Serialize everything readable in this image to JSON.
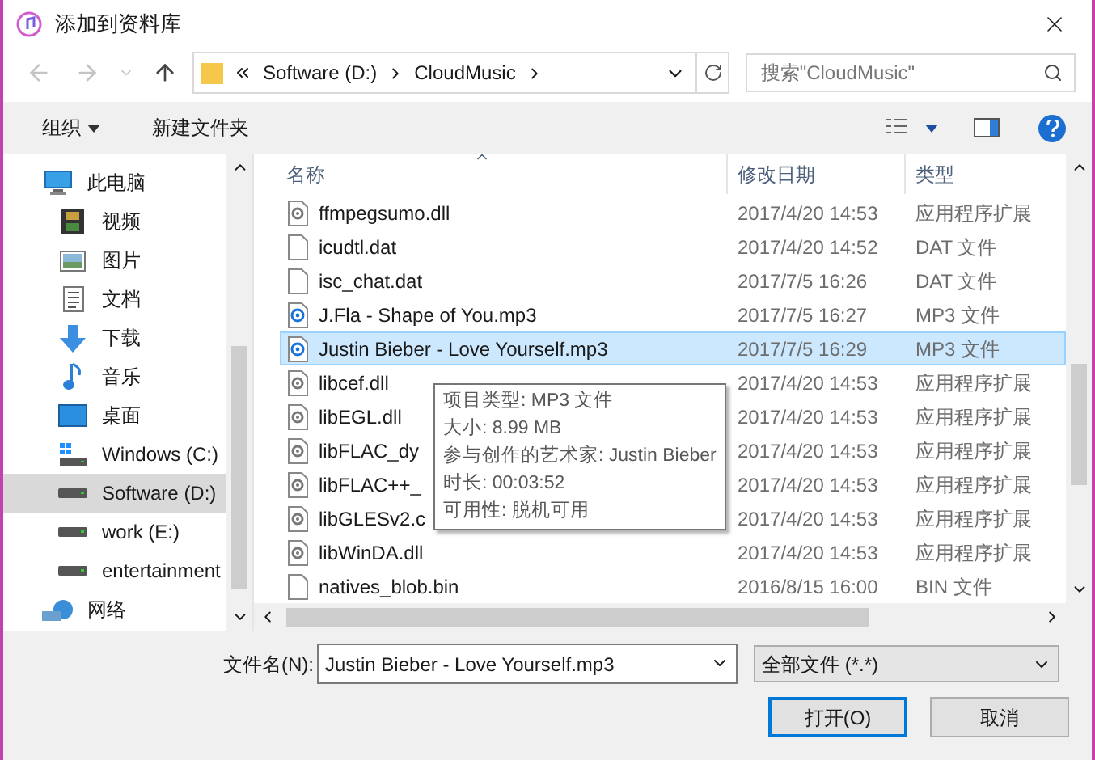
{
  "window": {
    "title": "添加到资料库"
  },
  "nav_buttons": [
    {
      "kind": "back",
      "disabled": true
    },
    {
      "kind": "forward",
      "disabled": true
    },
    {
      "kind": "recent",
      "disabled": true
    },
    {
      "kind": "up",
      "disabled": false
    }
  ],
  "address": {
    "crumbs": [
      "Software (D:)",
      "CloudMusic"
    ]
  },
  "search": {
    "placeholder": "搜索\"CloudMusic\""
  },
  "toolbar": {
    "organize": "组织",
    "new_folder": "新建文件夹"
  },
  "sidebar": {
    "items": [
      {
        "label": "此电脑",
        "kind": "computer",
        "selected": false,
        "children": [
          {
            "label": "视频",
            "kind": "video",
            "selected": false
          },
          {
            "label": "图片",
            "kind": "pictures",
            "selected": false
          },
          {
            "label": "文档",
            "kind": "documents",
            "selected": false
          },
          {
            "label": "下载",
            "kind": "downloads",
            "selected": false
          },
          {
            "label": "音乐",
            "kind": "music",
            "selected": false
          },
          {
            "label": "桌面",
            "kind": "desktop",
            "selected": false
          },
          {
            "label": "Windows (C:)",
            "kind": "system-drive",
            "selected": false
          },
          {
            "label": "Software (D:)",
            "kind": "drive",
            "selected": true
          },
          {
            "label": "work (E:)",
            "kind": "drive",
            "selected": false
          },
          {
            "label": "entertainment",
            "kind": "drive",
            "selected": false
          }
        ]
      },
      {
        "label": "网络",
        "kind": "network",
        "selected": false
      }
    ]
  },
  "table": {
    "columns": [
      "名称",
      "修改日期",
      "类型"
    ],
    "rows": [
      {
        "name": "ffmpegsumo.dll",
        "date": "2017/4/20 14:53",
        "type": "应用程序扩展",
        "kind": "dll",
        "selected": false
      },
      {
        "name": "icudtl.dat",
        "date": "2017/4/20 14:52",
        "type": "DAT 文件",
        "kind": "file",
        "selected": false
      },
      {
        "name": "isc_chat.dat",
        "date": "2017/7/5 16:26",
        "type": "DAT 文件",
        "kind": "file",
        "selected": false
      },
      {
        "name": "J.Fla - Shape of You.mp3",
        "date": "2017/7/5 16:27",
        "type": "MP3 文件",
        "kind": "audio",
        "selected": false
      },
      {
        "name": "Justin Bieber - Love Yourself.mp3",
        "date": "2017/7/5 16:29",
        "type": "MP3 文件",
        "kind": "audio",
        "selected": true
      },
      {
        "name": "libcef.dll",
        "date": "2017/4/20 14:53",
        "type": "应用程序扩展",
        "kind": "dll",
        "selected": false
      },
      {
        "name": "libEGL.dll",
        "date": "2017/4/20 14:53",
        "type": "应用程序扩展",
        "kind": "dll",
        "selected": false
      },
      {
        "name": "libFLAC_dy",
        "date": "2017/4/20 14:53",
        "type": "应用程序扩展",
        "kind": "dll",
        "selected": false
      },
      {
        "name": "libFLAC++_",
        "date": "2017/4/20 14:53",
        "type": "应用程序扩展",
        "kind": "dll",
        "selected": false
      },
      {
        "name": "libGLESv2.c",
        "date": "2017/4/20 14:53",
        "type": "应用程序扩展",
        "kind": "dll",
        "selected": false
      },
      {
        "name": "libWinDA.dll",
        "date": "2017/4/20 14:53",
        "type": "应用程序扩展",
        "kind": "dll",
        "selected": false
      },
      {
        "name": "natives_blob.bin",
        "date": "2016/8/15 16:00",
        "type": "BIN 文件",
        "kind": "file",
        "selected": false
      }
    ]
  },
  "tooltip": {
    "lines": [
      "项目类型: MP3 文件",
      "大小: 8.99 MB",
      "参与创作的艺术家: Justin Bieber",
      "时长: 00:03:52",
      "可用性: 脱机可用"
    ]
  },
  "bottom": {
    "filename_label": "文件名(N):",
    "filename_value": "Justin Bieber - Love Yourself.mp3",
    "filter": "全部文件 (*.*)",
    "buttons": [
      {
        "label": "打开(O)",
        "default": true
      },
      {
        "label": "取消",
        "default": false
      }
    ]
  }
}
